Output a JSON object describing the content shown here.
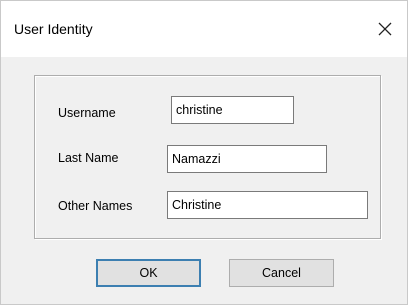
{
  "window": {
    "title": "User Identity"
  },
  "form": {
    "username": {
      "label": "Username",
      "value": "christine"
    },
    "last_name": {
      "label": "Last Name",
      "value": "Namazzi"
    },
    "other_names": {
      "label": "Other Names",
      "value": "Christine"
    }
  },
  "buttons": {
    "ok_label": "OK",
    "cancel_label": "Cancel"
  },
  "icons": {
    "close": "close-icon"
  }
}
